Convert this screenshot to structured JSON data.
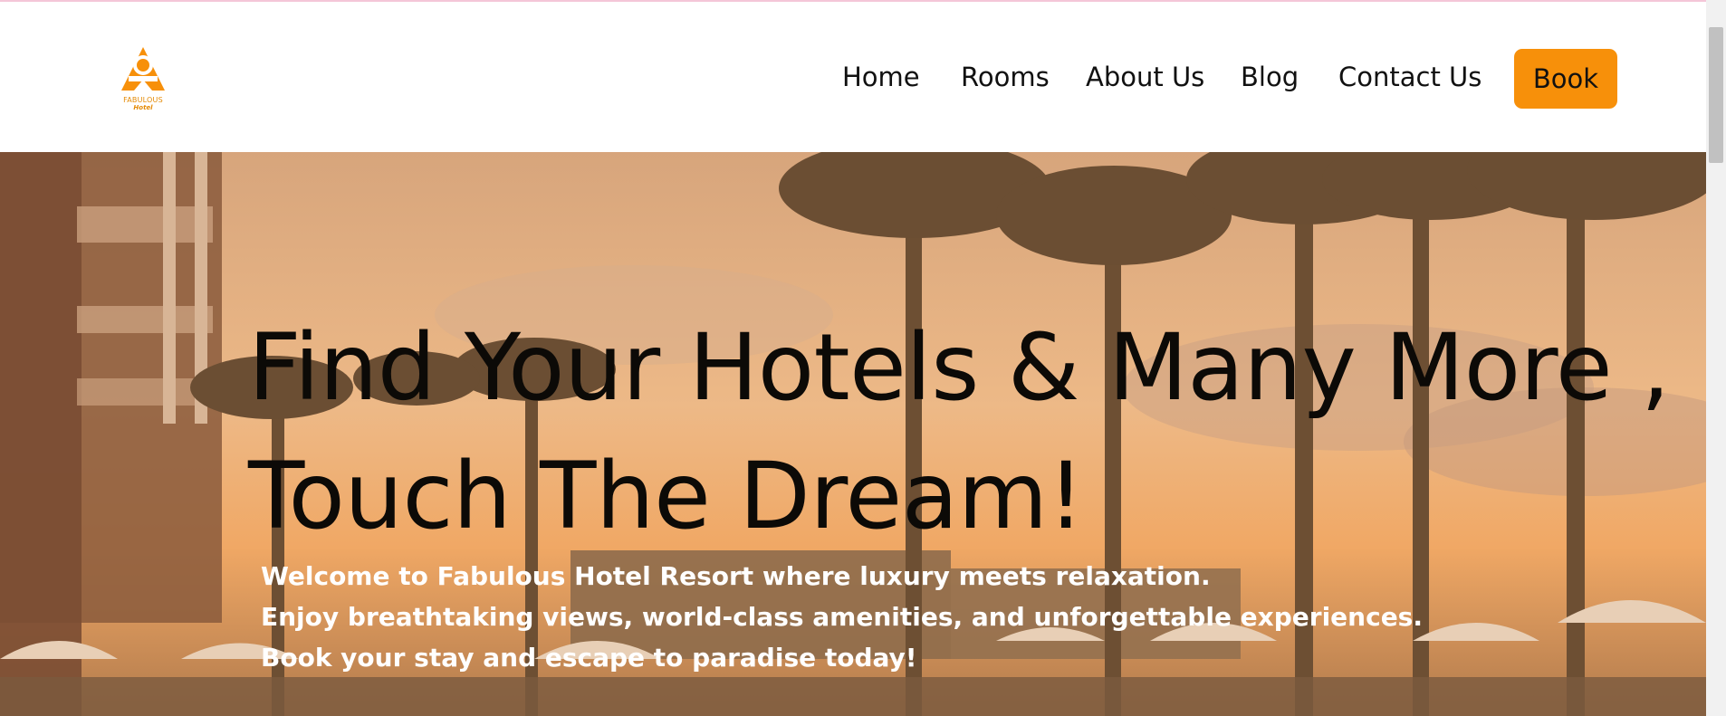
{
  "brand": {
    "logo_line1": "FABULOUS",
    "logo_line2": "Hotel",
    "accent_color": "#f7900a"
  },
  "nav": {
    "items": [
      {
        "label": "Home"
      },
      {
        "label": "Rooms"
      },
      {
        "label": "About Us"
      },
      {
        "label": "Blog"
      },
      {
        "label": "Contact Us"
      }
    ],
    "book_label": "Book"
  },
  "hero": {
    "title_line1": "Find Your Hotels & Many More ,",
    "title_line2": "Touch The Dream!",
    "subtitle_lines": [
      "Welcome to Fabulous Hotel Resort where luxury meets relaxation.",
      "Enjoy breathtaking views, world-class amenities, and unforgettable experiences.",
      "Book your stay and escape to paradise today!"
    ]
  }
}
